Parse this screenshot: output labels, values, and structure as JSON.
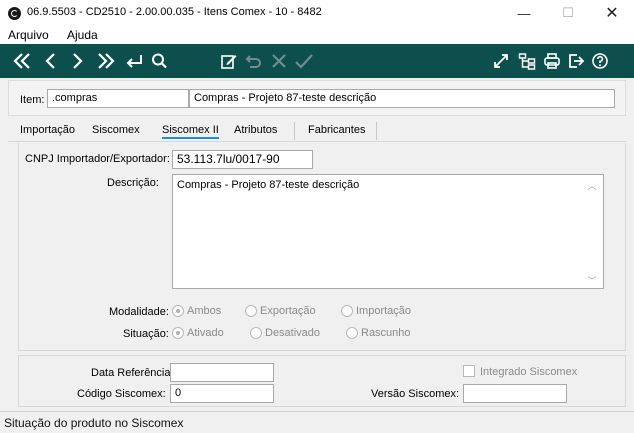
{
  "window": {
    "title": "06.9.5503 - CD2510 - 2.00.00.035 - Itens Comex - 10 - 8482",
    "minimize": "—",
    "maximize": "☐",
    "close": "✕"
  },
  "menu": [
    "Arquivo",
    "Ajuda"
  ],
  "toolbar": {
    "colors": {
      "background": "#0d4f4c",
      "icon": "#ffffff",
      "disabled_icon": "#6e8f8d"
    },
    "left_icons": [
      "first-icon",
      "previous-icon",
      "next-icon",
      "last-icon",
      "return-icon",
      "search-icon"
    ],
    "middle_icons": [
      "edit-icon",
      "undo-icon",
      "cancel-icon",
      "confirm-icon"
    ],
    "right_icons": [
      "refresh-icon",
      "tree-icon",
      "print-icon",
      "exit-icon",
      "help-icon"
    ]
  },
  "item": {
    "label": "Item:",
    "code": ".compras",
    "description": "Compras - Projeto 87-teste descrição"
  },
  "tabs": [
    {
      "label": "Importação",
      "active": false
    },
    {
      "label": "Siscomex",
      "active": false
    },
    {
      "label": "Siscomex II",
      "active": true
    },
    {
      "label": "Atributos",
      "active": false
    },
    {
      "label": "Fabricantes",
      "active": false
    }
  ],
  "siscomex2": {
    "cnpj_label": "CNPJ Importador/Exportador:",
    "cnpj_value": "53.113.7lu/0017-90",
    "descricao_label": "Descrição:",
    "descricao_value": "Compras - Projeto 87-teste descrição",
    "modalidade_label": "Modalidade:",
    "modalidade_options": [
      "Ambos",
      "Exportação",
      "Importação"
    ],
    "modalidade_selected": "Ambos",
    "situacao_label": "Situação:",
    "situacao_options": [
      "Ativado",
      "Desativado",
      "Rascunho"
    ],
    "situacao_selected": "Ativado"
  },
  "bottom": {
    "data_referencia_label": "Data Referência:",
    "data_referencia_value": "",
    "integrado_label": "Integrado Siscomex",
    "codigo_label": "Código Siscomex:",
    "codigo_value": "0",
    "versao_label": "Versão Siscomex:",
    "versao_value": ""
  },
  "status": "Situação do produto no Siscomex"
}
